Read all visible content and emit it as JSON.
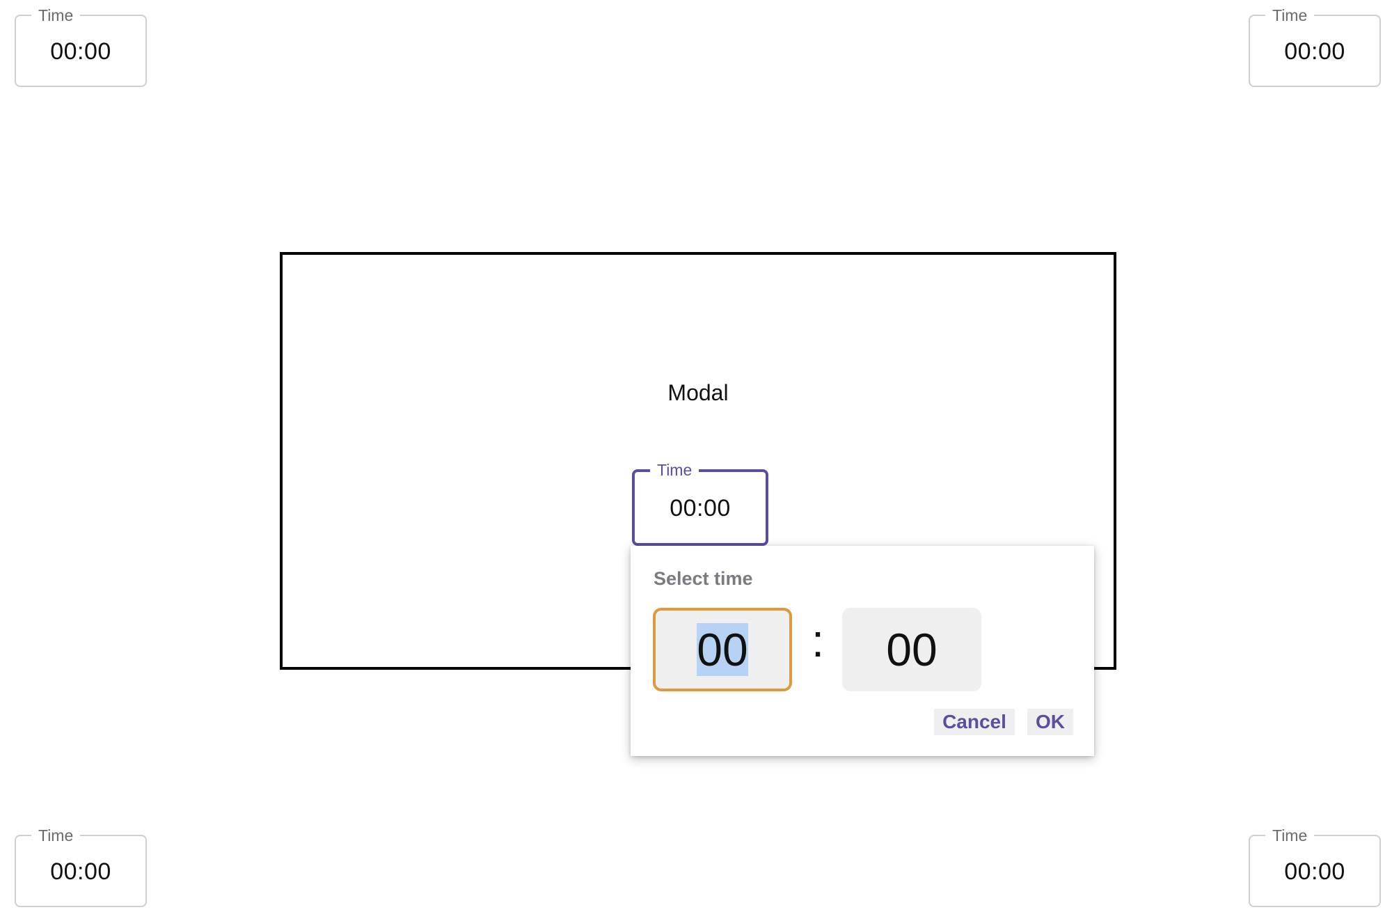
{
  "corner_fields": {
    "top_left": {
      "label": "Time",
      "value": "00:00"
    },
    "top_right": {
      "label": "Time",
      "value": "00:00"
    },
    "bottom_left": {
      "label": "Time",
      "value": "00:00"
    },
    "bottom_right": {
      "label": "Time",
      "value": "00:00"
    }
  },
  "modal": {
    "title": "Modal",
    "time_field": {
      "label": "Time",
      "value": "00:00"
    }
  },
  "picker": {
    "heading": "Select time",
    "hour": "00",
    "separator": ":",
    "minute": "00",
    "cancel_label": "Cancel",
    "ok_label": "OK"
  },
  "colors": {
    "accent": "#5e4ca0",
    "focus_outline": "#dc9a3c",
    "selection": "#b6d3f5"
  }
}
